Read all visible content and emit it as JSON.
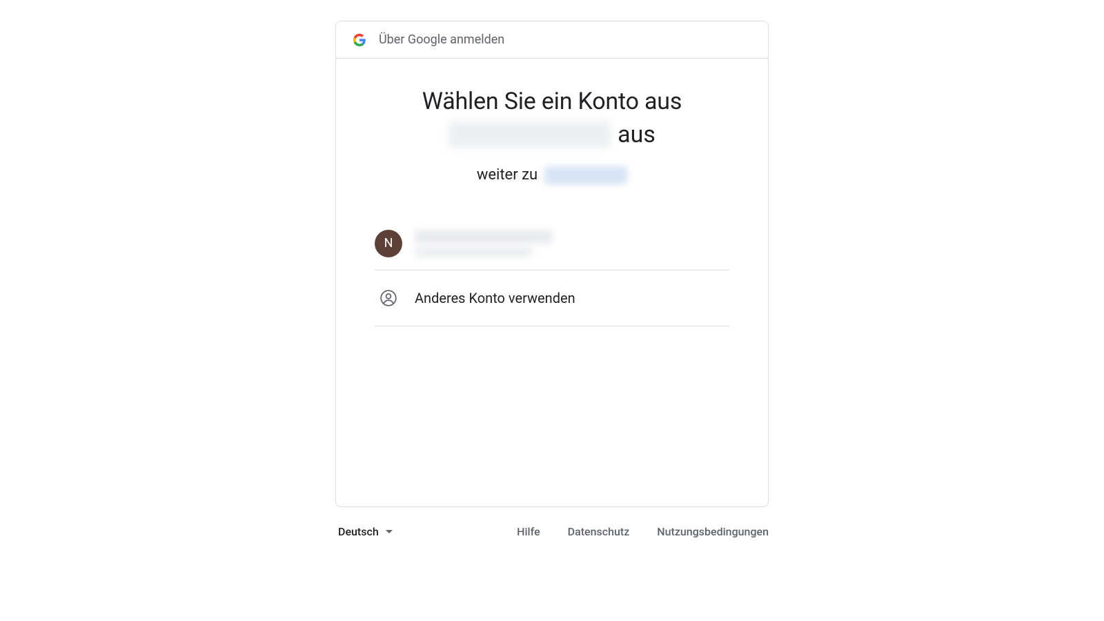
{
  "header": {
    "title": "Über Google anmelden"
  },
  "headline": {
    "line1": "Wählen Sie ein Konto aus",
    "suffix": "aus",
    "continue_prefix": "weiter zu"
  },
  "accounts": [
    {
      "initial": "N"
    }
  ],
  "other_account_label": "Anderes Konto verwenden",
  "footer": {
    "language": "Deutsch",
    "links": {
      "help": "Hilfe",
      "privacy": "Datenschutz",
      "terms": "Nutzungsbedingungen"
    }
  }
}
